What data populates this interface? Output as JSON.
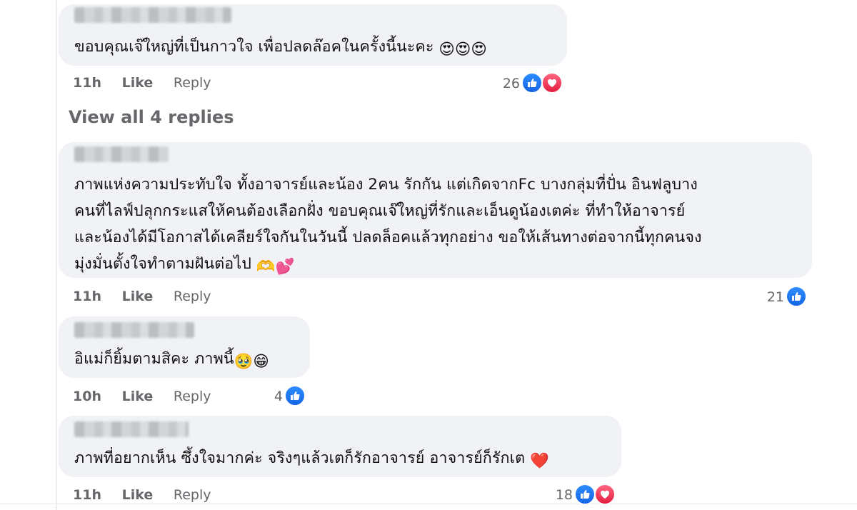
{
  "comments": [
    {
      "lines": [
        "ขอบคุณเจ๊ใหญ่ที่เป็นกาวใจ เพื่อปลดล๊อคในครั้งนี้นะคะ"
      ],
      "emoji_after": [
        "😍",
        "😍",
        "😍"
      ],
      "time": "11h",
      "like_label": "Like",
      "reply_label": "Reply",
      "reaction_count": "26",
      "reactions": [
        "like-icon",
        "love-icon"
      ]
    },
    {
      "lines": [
        "ภาพแห่งความประทับใจ ทั้งอาจารย์และน้อง 2คน รักกัน แต่เกิดจากFc บางกลุ่มที่ปั่น อินฟลูบาง",
        "คนที่ไลฟ์ปลุกกระแสให้คนต้องเลือกฝั่ง ขอบคุณเจ๊ใหญ่ที่รักและเอ็นดูน้องเตค่ะ ที่ทำให้อาจารย์",
        "และน้องได้มีโอกาสได้เคลียร์ใจกันในวันนี้ ปลดล็อคแล้วทุกอย่าง ขอให้เส้นทางต่อจากนี้ทุกคนจง",
        "มุ่งมั่นตั้งใจทำตามฝันต่อไป"
      ],
      "emoji_after": [
        "🫶",
        "💕"
      ],
      "time": "11h",
      "like_label": "Like",
      "reply_label": "Reply",
      "reaction_count": "21",
      "reactions": [
        "like-icon"
      ]
    },
    {
      "lines": [
        "อิแม่ก็ยิ้มตามสิคะ ภาพนี้"
      ],
      "emoji_after": [
        "🥹",
        "😁"
      ],
      "time": "10h",
      "like_label": "Like",
      "reply_label": "Reply",
      "reaction_count": "4",
      "reactions": [
        "like-icon"
      ]
    },
    {
      "lines": [
        "ภาพที่อยากเห็น ซึ้งใจมากค่ะ จริงๆแล้วเตก็รักอาจารย์ อาจารย์ก็รักเต"
      ],
      "emoji_after": [
        "❤️"
      ],
      "time": "11h",
      "like_label": "Like",
      "reply_label": "Reply",
      "reaction_count": "18",
      "reactions": [
        "like-icon",
        "love-icon"
      ]
    }
  ],
  "view_replies_label": "View all 4 replies",
  "colors": {
    "bubble": "#f0f2f5",
    "meta_text": "#65676b",
    "like_blue": "#1877f2",
    "love_red": "#e41e3f"
  }
}
